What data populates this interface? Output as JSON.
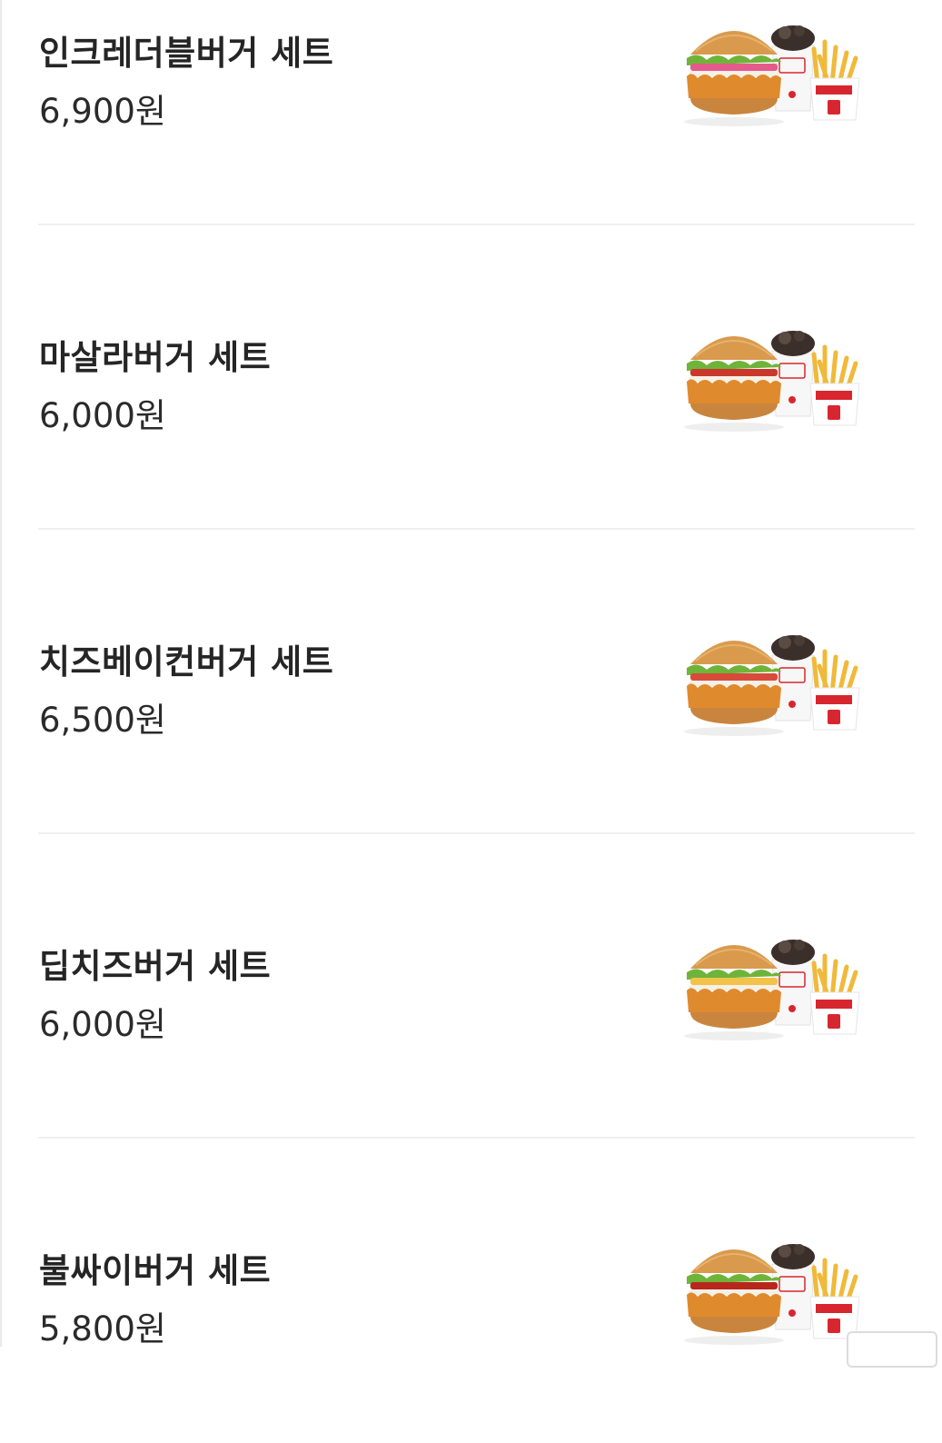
{
  "menu": {
    "items": [
      {
        "name": "인크레더블버거 세트",
        "price": "6,900원",
        "image": "burger-set-image",
        "accent": "#e45a8a"
      },
      {
        "name": "마살라버거 세트",
        "price": "6,000원",
        "image": "burger-set-image",
        "accent": "#c9382a"
      },
      {
        "name": "치즈베이컨버거 세트",
        "price": "6,500원",
        "image": "burger-set-image",
        "accent": "#d84a3a"
      },
      {
        "name": "딥치즈버거 세트",
        "price": "6,000원",
        "image": "burger-set-image",
        "accent": "#f2c24a"
      },
      {
        "name": "불싸이버거 세트",
        "price": "5,800원",
        "image": "burger-set-image",
        "accent": "#b8261c"
      }
    ]
  },
  "colors": {
    "brand_red": "#d8262f",
    "bun": "#d99a4e",
    "lettuce": "#6fb43a",
    "crispy": "#e08a2e",
    "drink": "#3a2f2a",
    "fries": "#f0b93a"
  }
}
